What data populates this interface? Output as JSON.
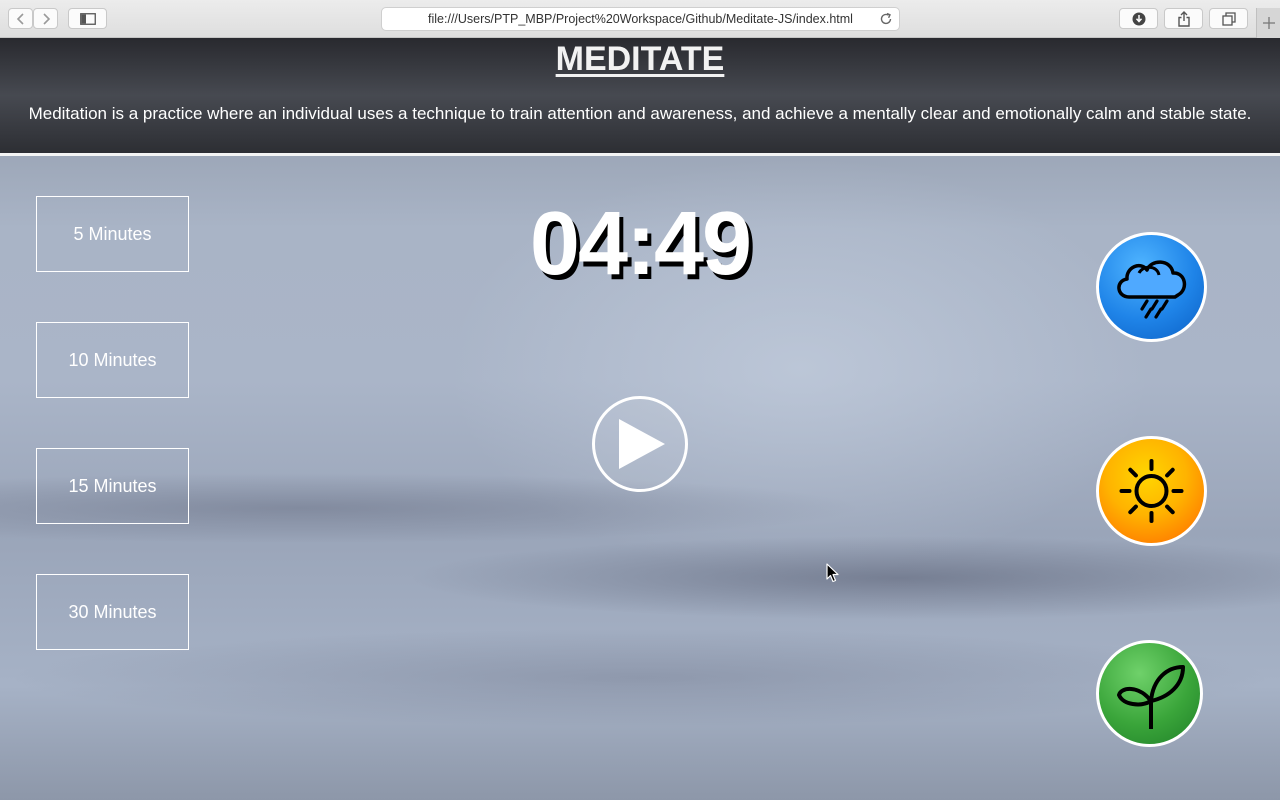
{
  "browser": {
    "url": "file:///Users/PTP_MBP/Project%20Workspace/Github/Meditate-JS/index.html"
  },
  "header": {
    "title": "MEDITATE",
    "description": "Meditation is a practice where an individual uses a technique to train attention and awareness, and achieve a mentally clear and emotionally calm and stable state."
  },
  "durations": [
    {
      "label": "5 Minutes"
    },
    {
      "label": "10 Minutes"
    },
    {
      "label": "15 Minutes"
    },
    {
      "label": "30 Minutes"
    }
  ],
  "timer": {
    "display": "04:49"
  },
  "sounds": [
    {
      "icon": "rain-cloud-icon",
      "color": "#1f84e8"
    },
    {
      "icon": "sun-icon",
      "color": "#ffb300"
    },
    {
      "icon": "sprout-icon",
      "color": "#3aa53a"
    }
  ],
  "icons": {
    "play": "play-icon"
  }
}
